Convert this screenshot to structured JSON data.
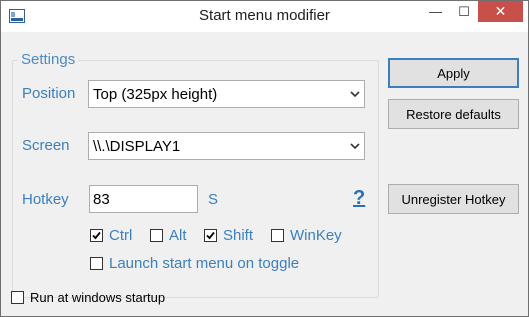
{
  "window": {
    "title": "Start menu modifier",
    "minimize_glyph": "—",
    "maximize_glyph": "☐",
    "close_glyph": "✕"
  },
  "settings": {
    "group_label": "Settings",
    "position": {
      "label": "Position",
      "value": "Top (325px height)"
    },
    "screen": {
      "label": "Screen",
      "value": "\\\\.\\DISPLAY1"
    },
    "hotkey": {
      "label": "Hotkey",
      "value": "83",
      "key_letter": "S",
      "help_glyph": "?"
    },
    "modifiers": [
      {
        "label": "Ctrl",
        "checked": true
      },
      {
        "label": "Alt",
        "checked": false
      },
      {
        "label": "Shift",
        "checked": true
      },
      {
        "label": "WinKey",
        "checked": false
      }
    ],
    "launch_on_toggle": {
      "label": "Launch start menu on toggle",
      "checked": false
    }
  },
  "run_at_startup": {
    "label": "Run at windows startup",
    "checked": false
  },
  "buttons": {
    "apply": "Apply",
    "restore": "Restore defaults",
    "unregister": "Unregister Hotkey"
  },
  "colors": {
    "accent_label": "#3c7fbf",
    "close_button": "#c7514a",
    "default_button_border": "#3c7fbf"
  }
}
